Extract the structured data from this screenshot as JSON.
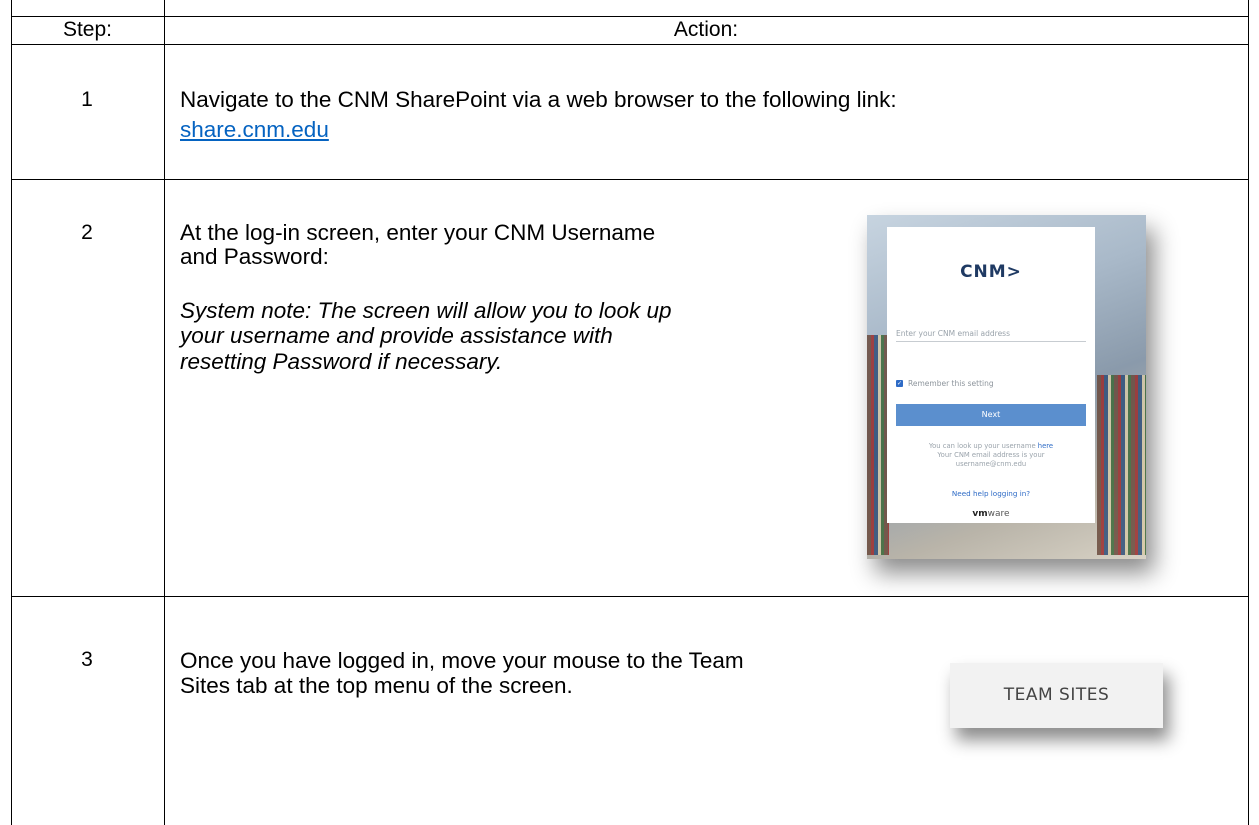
{
  "header": {
    "step_label": "Step:",
    "action_label": "Action:"
  },
  "rows": [
    {
      "step": "1",
      "lines": [
        "Navigate to the CNM SharePoint via a web browser to the following link:"
      ],
      "link": "share.cnm.edu"
    },
    {
      "step": "2",
      "lines": [
        "At the log-in screen, enter your CNM Username",
        "and Password:"
      ],
      "note_lines": [
        "System note: The screen will allow you to look up",
        "your username and provide assistance with",
        "resetting Password if necessary."
      ],
      "screenshot": {
        "logo": "CNM>",
        "email_placeholder": "Enter your CNM email address",
        "remember": "Remember this setting",
        "next": "Next",
        "help_1a": "You can look up your username ",
        "help_1b": "here",
        "help_2": "Your CNM email address is your",
        "help_3": "username@cnm.edu",
        "need_help": "Need help logging in?",
        "vendor_a": "vm",
        "vendor_b": "ware"
      }
    },
    {
      "step": "3",
      "lines": [
        "Once you have logged in, move your mouse to the Team",
        "Sites tab at the top menu of the screen."
      ],
      "screenshot": {
        "tab": "TEAM SITES"
      }
    }
  ],
  "colors": {
    "link": "#0563c1",
    "brand_blue": "#5b8fce",
    "logo_navy": "#1f3a63"
  }
}
